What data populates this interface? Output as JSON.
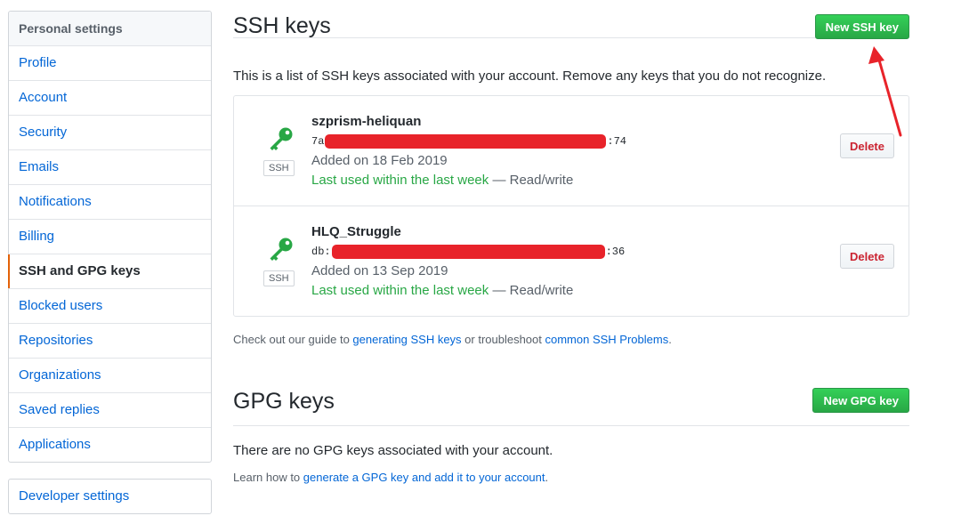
{
  "sidebar": {
    "heading": "Personal settings",
    "items": [
      {
        "label": "Profile"
      },
      {
        "label": "Account"
      },
      {
        "label": "Security"
      },
      {
        "label": "Emails"
      },
      {
        "label": "Notifications"
      },
      {
        "label": "Billing"
      },
      {
        "label": "SSH and GPG keys",
        "selected": true
      },
      {
        "label": "Blocked users"
      },
      {
        "label": "Repositories"
      },
      {
        "label": "Organizations"
      },
      {
        "label": "Saved replies"
      },
      {
        "label": "Applications"
      }
    ],
    "developer_settings": "Developer settings"
  },
  "ssh": {
    "title": "SSH keys",
    "new_button": "New SSH key",
    "intro": "This is a list of SSH keys associated with your account. Remove any keys that you do not recognize.",
    "keys": [
      {
        "name": "szprism-heliquan",
        "fingerprint_start": "7a",
        "fingerprint_end": ":74",
        "type_label": "SSH",
        "added": "Added on 18 Feb 2019",
        "last_used": "Last used within the last week",
        "access": " — Read/write",
        "delete_label": "Delete"
      },
      {
        "name": "HLQ_Struggle",
        "fingerprint_start": "db:",
        "fingerprint_end": ":36",
        "type_label": "SSH",
        "added": "Added on 13 Sep 2019",
        "last_used": "Last used within the last week",
        "access": " — Read/write",
        "delete_label": "Delete"
      }
    ],
    "guide": {
      "prefix": "Check out our guide to ",
      "link1": "generating SSH keys",
      "middle": " or troubleshoot ",
      "link2": "common SSH Problems",
      "suffix": "."
    }
  },
  "gpg": {
    "title": "GPG keys",
    "new_button": "New GPG key",
    "empty": "There are no GPG keys associated with your account.",
    "learn": {
      "prefix": "Learn how to ",
      "link": "generate a GPG key and add it to your account",
      "suffix": "."
    }
  },
  "colors": {
    "link": "#0366d6",
    "success": "#28a745",
    "danger": "#cb2431",
    "selected_marker": "#e36209",
    "redaction": "#e8232a"
  },
  "icons": {
    "key": "key-icon",
    "annotation": "arrow-annotation"
  }
}
